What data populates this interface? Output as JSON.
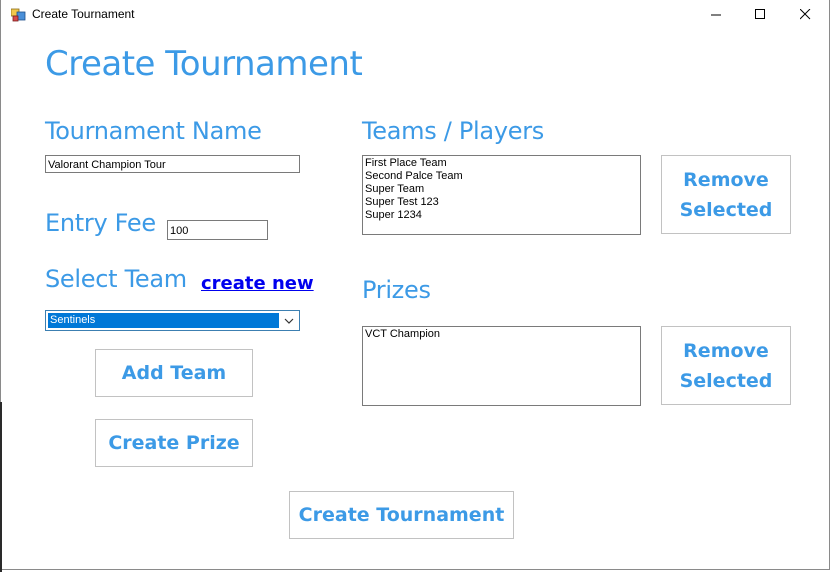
{
  "window": {
    "title": "Create Tournament",
    "minimize_glyph": "—",
    "maximize_glyph": "☐",
    "close_glyph": "✕"
  },
  "form": {
    "heading": "Create Tournament",
    "tournament_name_label": "Tournament Name",
    "tournament_name_value": "Valorant Champion Tour",
    "entry_fee_label": "Entry Fee",
    "entry_fee_value": "100",
    "select_team_label": "Select Team",
    "create_new_link": "create new",
    "selected_team": "Sentinels",
    "add_team_button": "Add Team",
    "create_prize_button": "Create Prize",
    "create_tournament_button": "Create Tournament"
  },
  "teams": {
    "label": "Teams / Players",
    "items": [
      "First Place Team",
      "Second Palce Team",
      "Super Team",
      "Super Test 123",
      "Super 1234"
    ],
    "remove_button_line1": "Remove",
    "remove_button_line2": "Selected"
  },
  "prizes": {
    "label": "Prizes",
    "items": [
      "VCT Champion"
    ],
    "remove_button_line1": "Remove",
    "remove_button_line2": "Selected"
  },
  "colors": {
    "accent": "#3c9ae6",
    "link": "#0000ee",
    "selection": "#0078d7"
  }
}
